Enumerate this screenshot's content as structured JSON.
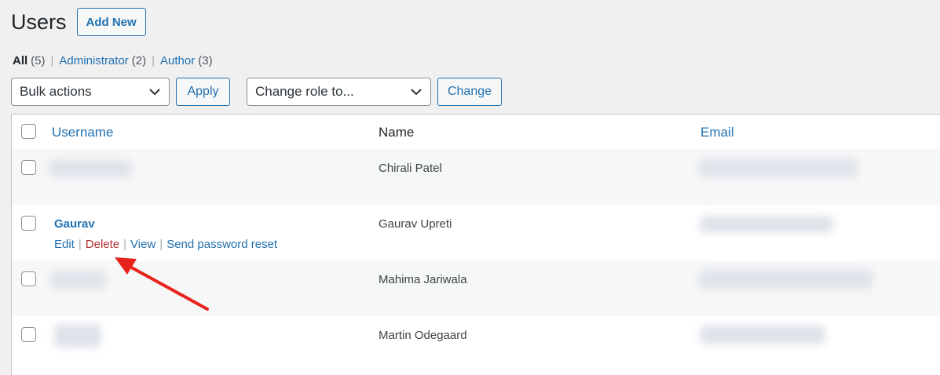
{
  "page": {
    "title": "Users",
    "add_new_label": "Add New"
  },
  "filters": [
    {
      "label": "All",
      "count": "(5)",
      "current": true
    },
    {
      "label": "Administrator",
      "count": "(2)",
      "current": false
    },
    {
      "label": "Author",
      "count": "(3)",
      "current": false
    }
  ],
  "toolbar": {
    "bulk_actions": "Bulk actions",
    "apply_label": "Apply",
    "change_role": "Change role to...",
    "change_label": "Change"
  },
  "table": {
    "columns": {
      "username": "Username",
      "name": "Name",
      "email": "Email"
    },
    "rows": [
      {
        "username": "",
        "name": "Chirali Patel"
      },
      {
        "username": "Gaurav",
        "name": "Gaurav Upreti",
        "actions": {
          "edit": "Edit",
          "delete": "Delete",
          "view": "View",
          "reset": "Send password reset"
        }
      },
      {
        "username": "",
        "name": "Mahima Jariwala"
      },
      {
        "username": "",
        "name": "Martin Odegaard"
      }
    ]
  },
  "colors": {
    "link": "#2271b1",
    "delete": "#b32d2e",
    "arrow": "#e8231b"
  },
  "icons": {
    "chevron": "chevron-down-icon",
    "arrow": "red-arrow-annotation"
  }
}
